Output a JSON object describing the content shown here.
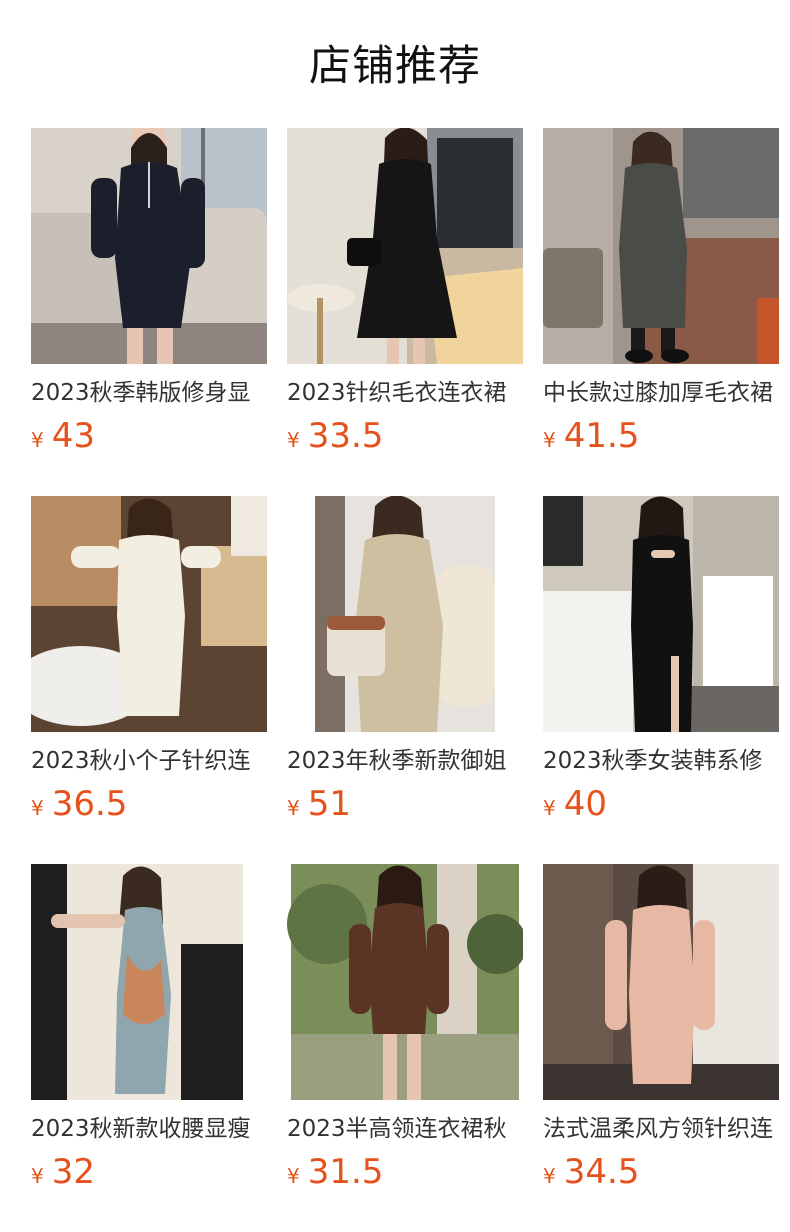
{
  "header": {
    "title": "店铺推荐"
  },
  "currency_symbol": "¥",
  "products": [
    {
      "name": "2023秋季韩版修身显",
      "price": "43",
      "image": "woman-black-zip-knit-dress-on-sofa",
      "colors": {
        "bg": "#d9d2ca",
        "dress": "#1b1f2c",
        "accent": "#f1ece6"
      }
    },
    {
      "name": "2023针织毛衣连衣裙",
      "price": "33.5",
      "image": "woman-black-knit-dress-with-bag-by-window",
      "colors": {
        "bg": "#e5e1da",
        "dress": "#151515",
        "accent": "#f0d7a8"
      }
    },
    {
      "name": "中长款过膝加厚毛衣裙",
      "price": "41.5",
      "image": "woman-grey-long-knit-dress-outdoor",
      "colors": {
        "bg": "#a89e96",
        "dress": "#4a4c48",
        "accent": "#a0573a"
      }
    },
    {
      "name": "2023秋小个子针织连",
      "price": "36.5",
      "image": "woman-cream-v-neck-knit-dress-indoor",
      "colors": {
        "bg": "#b88d63",
        "dress": "#f2eee2",
        "accent": "#5b4432"
      }
    },
    {
      "name": "2023年秋季新款御姐",
      "price": "51",
      "image": "woman-beige-collar-knit-dress-with-bag",
      "colors": {
        "bg": "#e6e3de",
        "dress": "#cdbf9f",
        "accent": "#9c5a3a"
      }
    },
    {
      "name": "2023秋季女装韩系修",
      "price": "40",
      "image": "woman-black-cutout-slit-dress-bathroom",
      "colors": {
        "bg": "#cfc8bd",
        "dress": "#111111",
        "accent": "#ffffff"
      }
    },
    {
      "name": "2023秋新款收腰显瘦",
      "price": "32",
      "image": "woman-blue-tie-dye-halter-dress-studio",
      "colors": {
        "bg": "#ede6db",
        "dress": "#8fa6ae",
        "accent": "#c9865c"
      }
    },
    {
      "name": "2023半高领连衣裙秋",
      "price": "31.5",
      "image": "woman-brown-knit-dress-garden",
      "colors": {
        "bg": "#7b8d58",
        "dress": "#5a3424",
        "accent": "#d9d2c5"
      }
    },
    {
      "name": "法式温柔风方领针织连",
      "price": "34.5",
      "image": "woman-pink-square-neck-knit-dress-indoor",
      "colors": {
        "bg": "#5a4c43",
        "dress": "#e7b9a4",
        "accent": "#e9e6e0"
      }
    }
  ]
}
